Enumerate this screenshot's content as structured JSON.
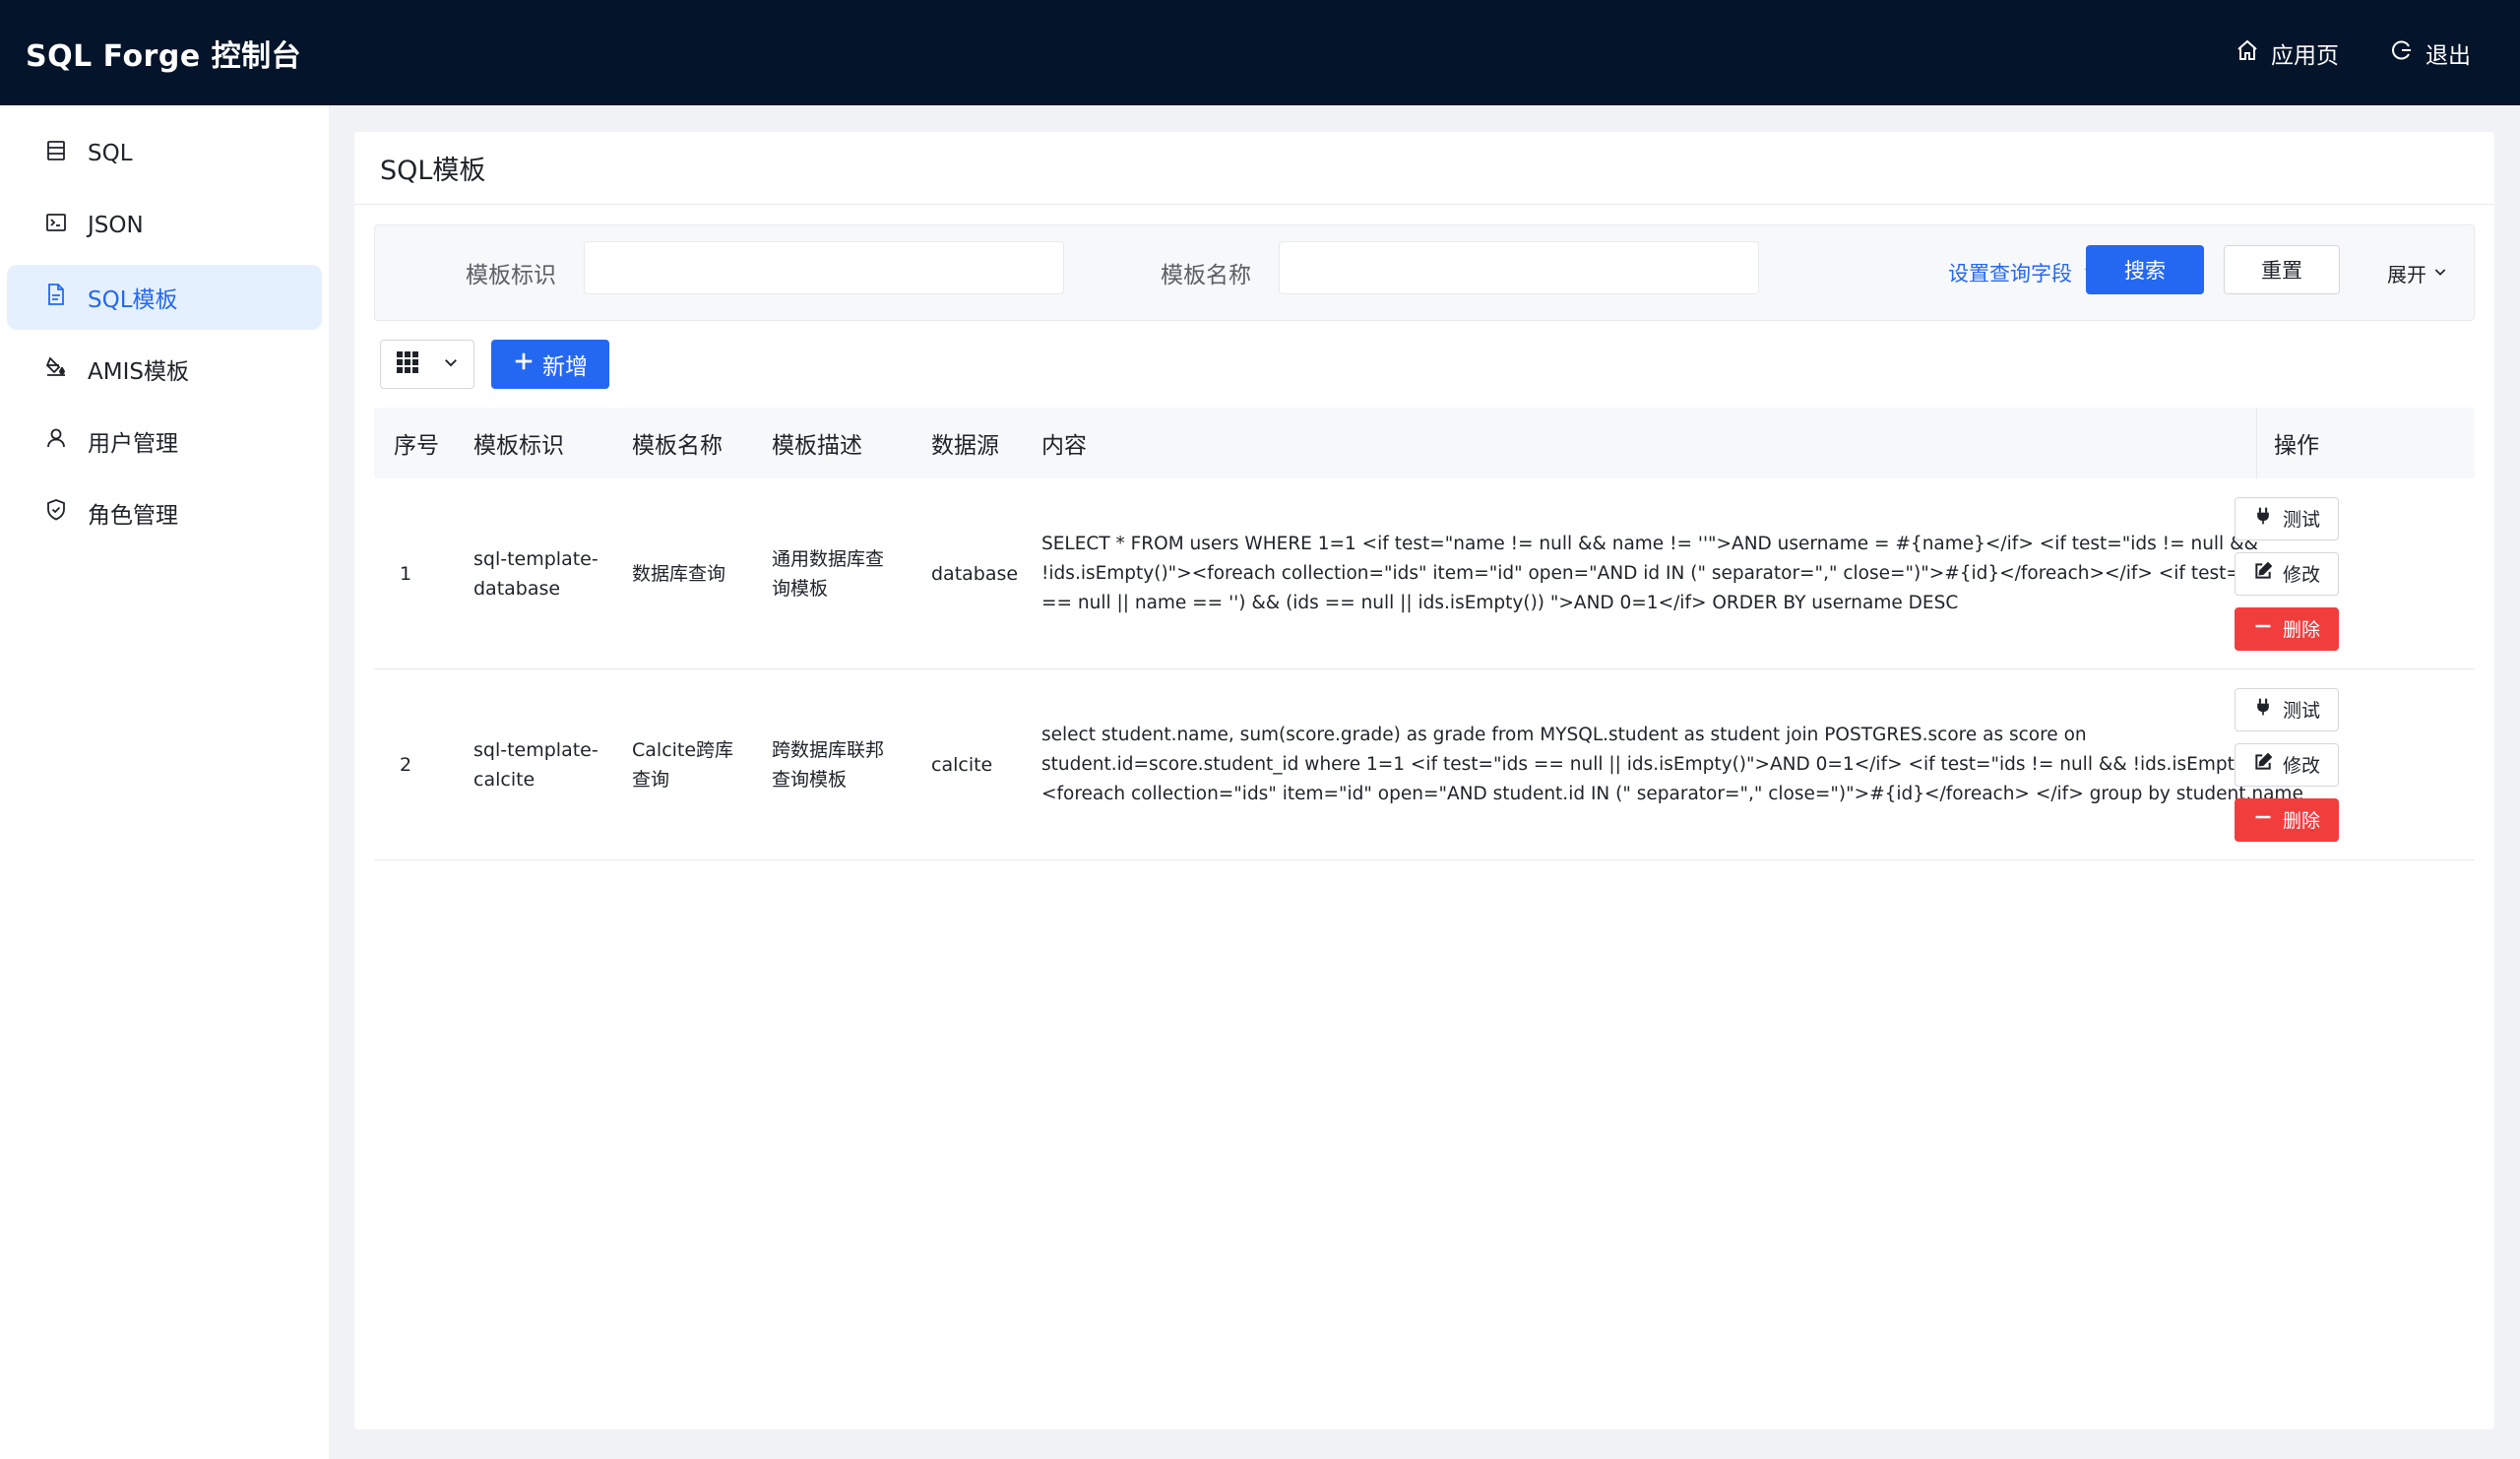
{
  "header": {
    "title": "SQL Forge 控制台",
    "app_link": "应用页",
    "logout": "退出"
  },
  "sidebar": {
    "items": [
      {
        "label": "SQL",
        "icon": "list-icon"
      },
      {
        "label": "JSON",
        "icon": "terminal-icon"
      },
      {
        "label": "SQL模板",
        "icon": "file-icon",
        "active": true
      },
      {
        "label": "AMIS模板",
        "icon": "paint-bucket-icon"
      },
      {
        "label": "用户管理",
        "icon": "user-icon"
      },
      {
        "label": "角色管理",
        "icon": "shield-icon"
      }
    ]
  },
  "page": {
    "title": "SQL模板"
  },
  "search": {
    "field1_label": "模板标识",
    "field1_value": "",
    "field2_label": "模板名称",
    "field2_value": "",
    "set_fields": "设置查询字段",
    "search_btn": "搜索",
    "reset_btn": "重置",
    "expand": "展开"
  },
  "toolbar": {
    "add_btn": "新增"
  },
  "table": {
    "columns": [
      "序号",
      "模板标识",
      "模板名称",
      "模板描述",
      "数据源",
      "内容",
      "操作"
    ],
    "rows": [
      {
        "index": "1",
        "identifier_l1": "sql-template-",
        "identifier_l2": "database",
        "name_l1": "数据库查询",
        "name_l2": "",
        "desc_l1": "通用数据库查",
        "desc_l2": "询模板",
        "datasource": "database",
        "content_l1": "SELECT * FROM users WHERE 1=1 <if test=\"name != null && name != ''\">AND username = #{name}</if> <if test=\"ids != null &&",
        "content_l2": "!ids.isEmpty()\"><foreach collection=\"ids\" item=\"id\" open=\"AND id IN (\" separator=\",\" close=\")\">#{id}</foreach></if> <if test=\"(name",
        "content_l3": "== null || name == '') && (ids == null || ids.isEmpty()) \">AND 0=1</if> ORDER BY username DESC"
      },
      {
        "index": "2",
        "identifier_l1": "sql-template-",
        "identifier_l2": "calcite",
        "name_l1": "Calcite跨库",
        "name_l2": "查询",
        "desc_l1": "跨数据库联邦",
        "desc_l2": "查询模板",
        "datasource": "calcite",
        "content_l1": "select student.name, sum(score.grade) as grade from MYSQL.student as student join POSTGRES.score as score on",
        "content_l2": "student.id=score.student_id where 1=1 <if test=\"ids == null || ids.isEmpty()\">AND 0=1</if> <if test=\"ids != null && !ids.isEmpty()\">",
        "content_l3": "<foreach collection=\"ids\" item=\"id\" open=\"AND student.id IN (\" separator=\",\" close=\")\">#{id}</foreach> </if> group by student.name"
      }
    ],
    "actions": {
      "test": "测试",
      "edit": "修改",
      "delete": "删除"
    }
  },
  "colors": {
    "header_bg": "#04142a",
    "primary": "#2468f2",
    "danger": "#f23d3d",
    "active_nav_bg": "#e5f0ff"
  }
}
